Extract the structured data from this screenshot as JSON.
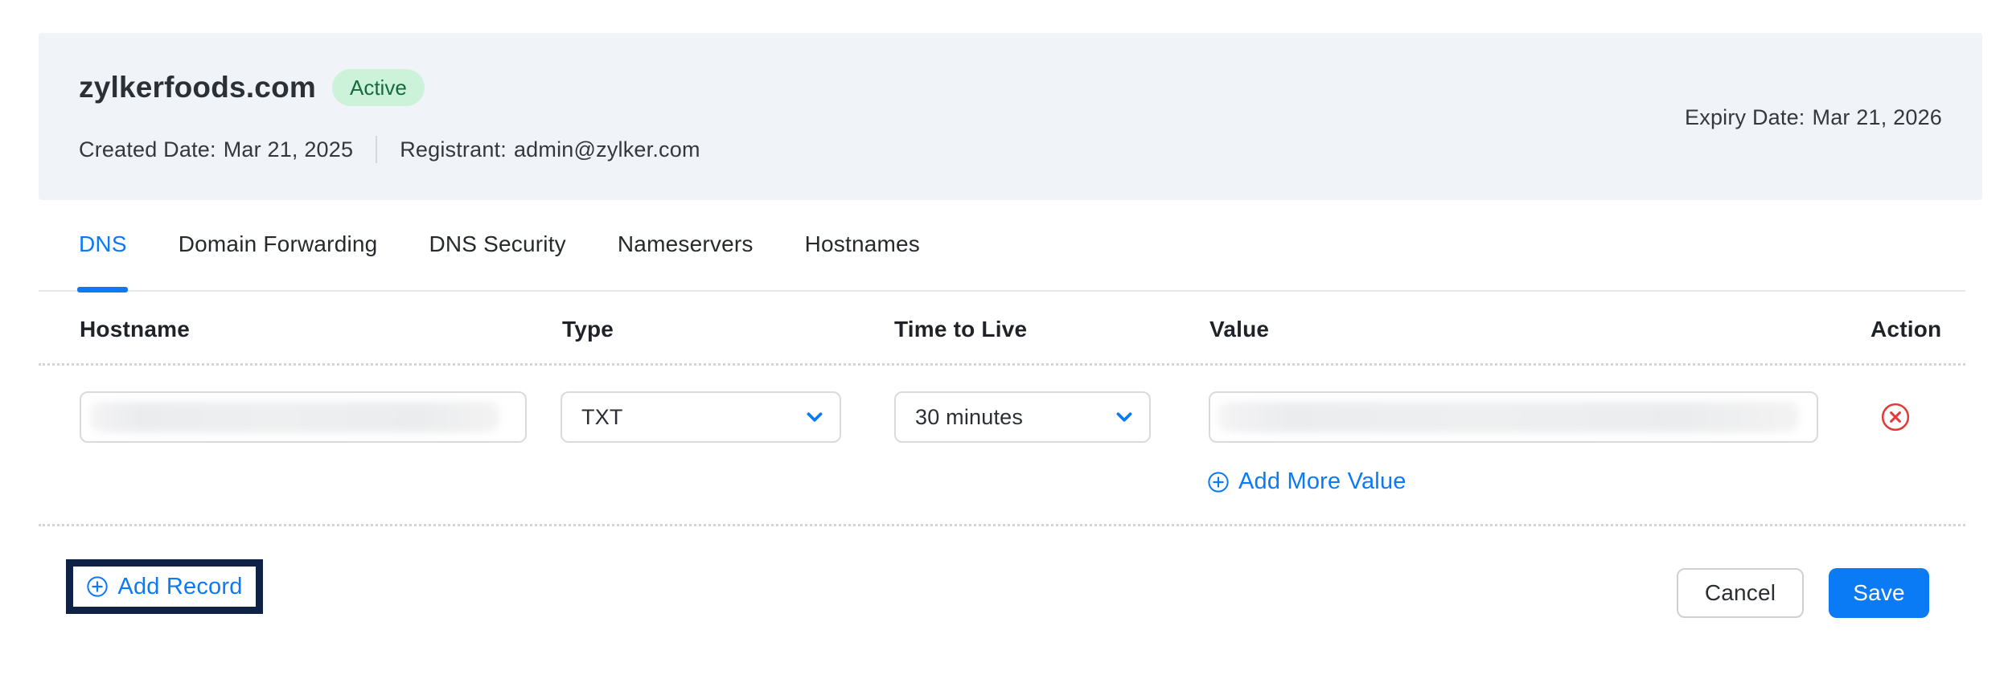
{
  "header": {
    "domain": "zylkerfoods.com",
    "status": "Active",
    "created": {
      "label": "Created Date:",
      "value": "Mar 21, 2025"
    },
    "registrant": {
      "label": "Registrant:",
      "value": "admin@zylker.com"
    },
    "expiry": {
      "label": "Expiry Date:",
      "value": "Mar 21, 2026"
    }
  },
  "tabs": [
    {
      "label": "DNS"
    },
    {
      "label": "Domain Forwarding"
    },
    {
      "label": "DNS Security"
    },
    {
      "label": "Nameservers"
    },
    {
      "label": "Hostnames"
    }
  ],
  "active_tab": "DNS",
  "dns_table": {
    "columns": {
      "hostname": "Hostname",
      "type": "Type",
      "ttl": "Time to Live",
      "value": "Value",
      "action": "Action"
    },
    "row": {
      "hostname_redacted": true,
      "type_selected": "TXT",
      "ttl_selected": "30 minutes",
      "value_redacted": true
    },
    "add_more_value_label": "Add More Value"
  },
  "footer": {
    "add_record_label": "Add Record",
    "cancel_label": "Cancel",
    "save_label": "Save"
  },
  "colors": {
    "accent_blue": "#0b7af5",
    "panel_bg": "#f0f3f7",
    "badge_bg": "#ccf3da",
    "badge_text": "#176a3c",
    "danger_red": "#e23a3a",
    "highlight_box_border": "#0f2145",
    "save_button_bg": "#0b7af5"
  },
  "icons": {
    "type_dropdown": "chevron-down-icon",
    "ttl_dropdown": "chevron-down-icon",
    "add_more_value": "plus-circle-icon",
    "add_record": "plus-circle-icon",
    "delete_row": "x-circle-icon"
  }
}
